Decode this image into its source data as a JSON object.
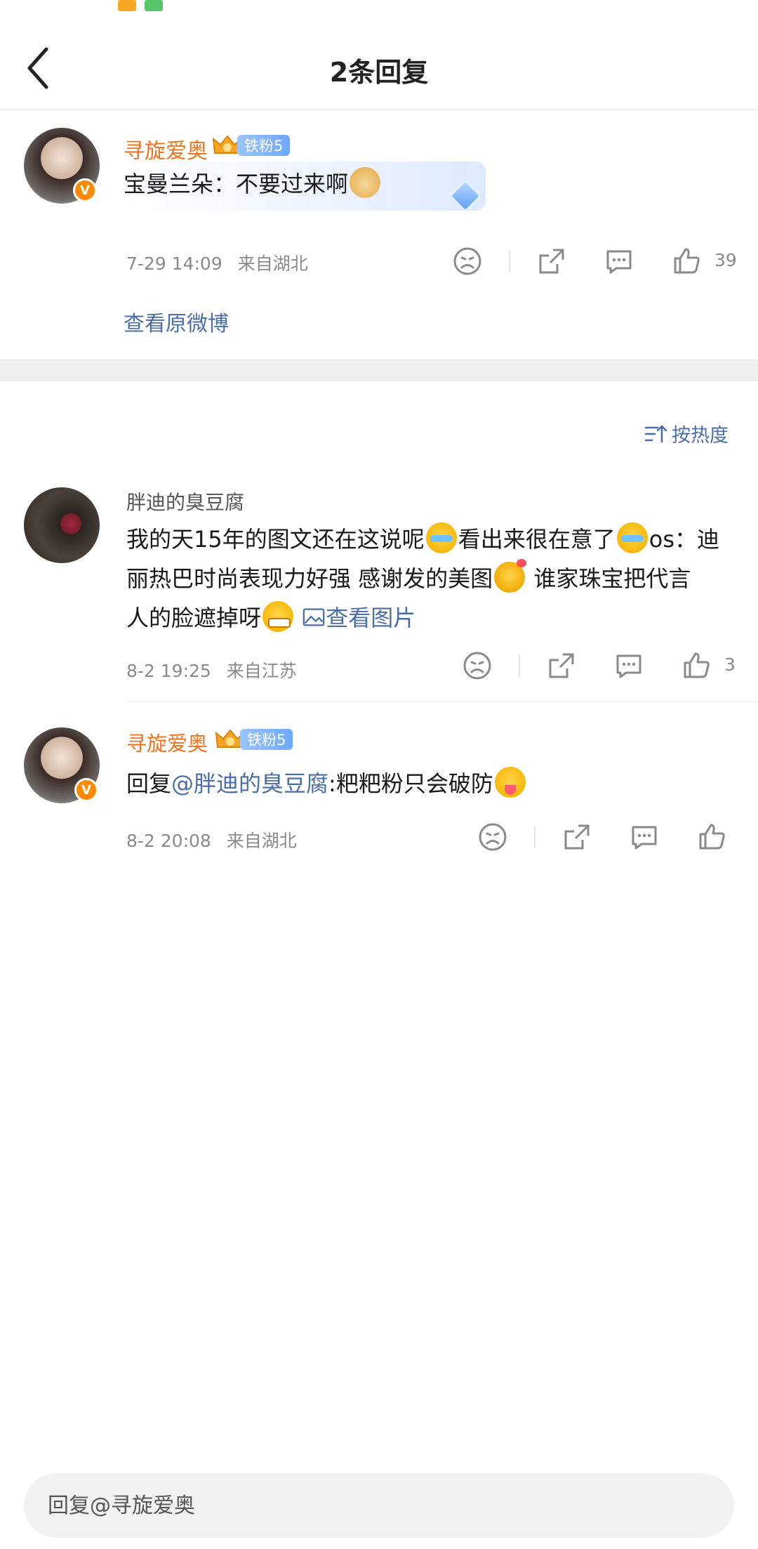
{
  "header": {
    "title": "2条回复",
    "back_icon": "chevron-left-icon"
  },
  "status_bar": {
    "icons": [
      "weibo-app-icon",
      "green-app-icon"
    ]
  },
  "root_comment": {
    "username": "寻旋爱奥",
    "fan_badge": "铁粉5",
    "text": "宝曼兰朵：不要过来啊",
    "emoji": "doge-emoji",
    "time": "7-29 14:09",
    "location": "来自湖北",
    "like_count": "39",
    "view_original": "查看原微博"
  },
  "sort": {
    "label": "按热度"
  },
  "replies": [
    {
      "username": "胖迪的臭豆腐",
      "line1_a": "我的天15年的图文还在这说呢",
      "line1_b": "看出来很在意了",
      "line1_c": "os：迪",
      "line2_a": "丽热巴时尚表现力好强 感谢发的美图",
      "line2_b": " 谁家珠宝把代言",
      "line3_a": "人的脸遮掉呀",
      "image_link": "查看图片",
      "time": "8-2 19:25",
      "location": "来自江苏",
      "like_count": "3"
    },
    {
      "username": "寻旋爱奥",
      "fan_badge": "铁粉5",
      "reply_prefix": "回复",
      "mention": "@胖迪的臭豆腐",
      "text": ":粑粑粉只会破防",
      "time": "8-2 20:08",
      "location": "来自湖北"
    }
  ],
  "reply_input": {
    "placeholder": "回复@寻旋爱奥"
  },
  "colors": {
    "orange_name": "#f0731d",
    "link_blue": "#4a6ea8",
    "meta_gray": "#8a8a8a",
    "v_badge": "#ff8a00"
  }
}
